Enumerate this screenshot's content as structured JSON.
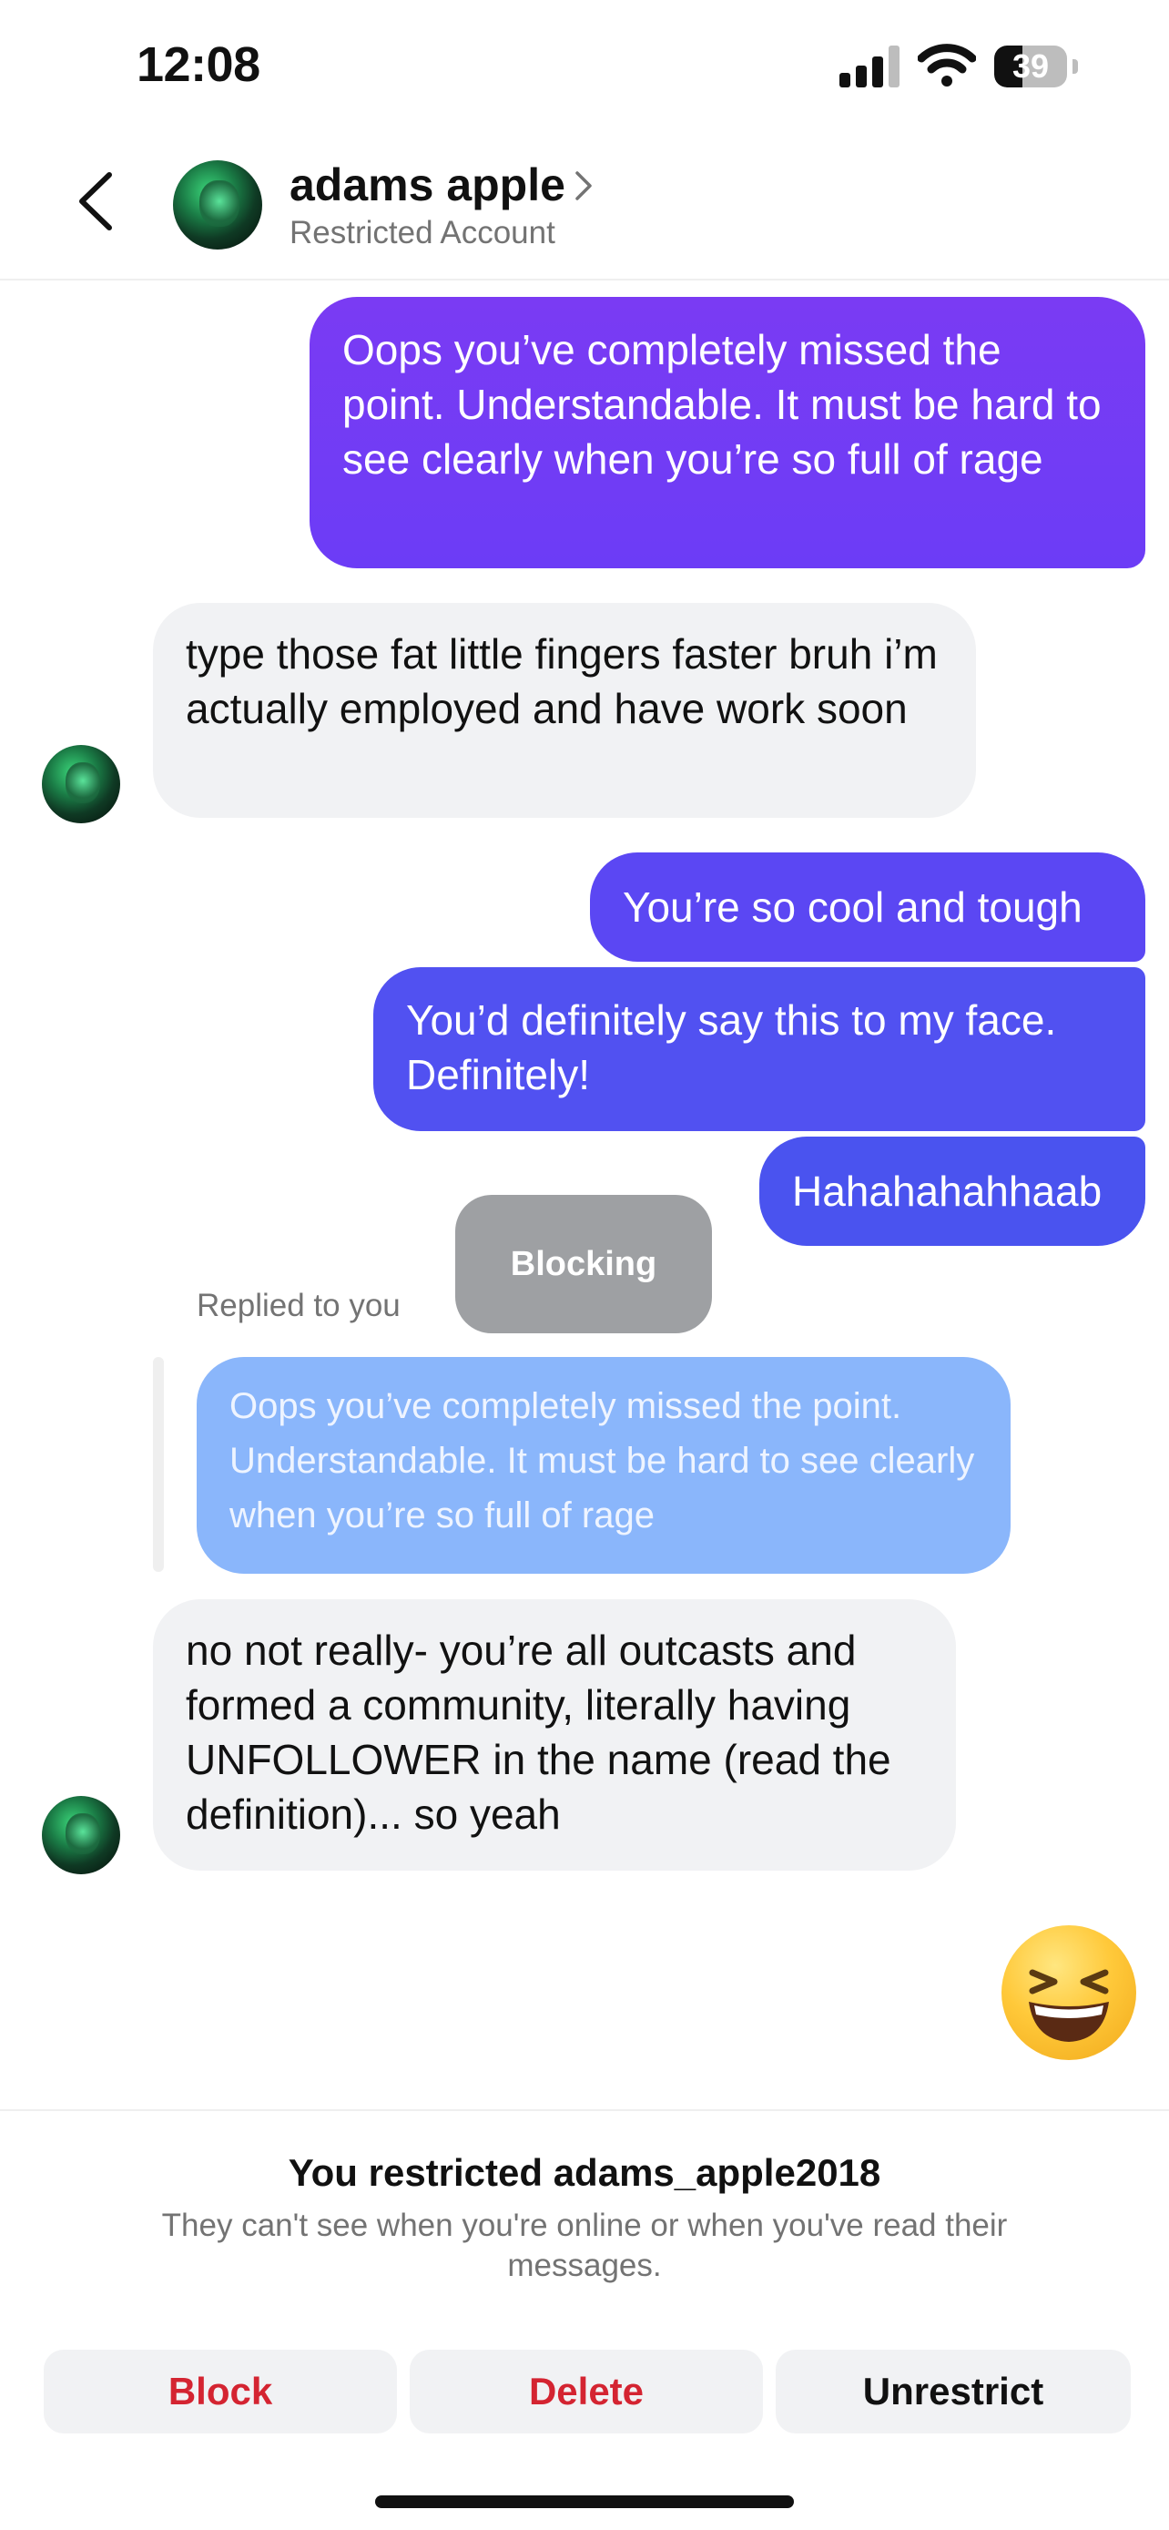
{
  "status_bar": {
    "time": "12:08",
    "battery": "39"
  },
  "header": {
    "name": "adams apple",
    "subtitle": "Restricted Account",
    "icons": {
      "back": "chevron-left-icon",
      "profile_chevron": "chevron-right-icon"
    }
  },
  "messages": [
    {
      "direction": "outgoing",
      "text": "Oops you’ve completely missed the point. Understandable. It must be hard to see clearly when you’re so full of rage"
    },
    {
      "direction": "incoming",
      "text": "type those fat little fingers faster bruh i’m actually employed and have work soon"
    },
    {
      "direction": "outgoing",
      "text": "You’re so cool and tough"
    },
    {
      "direction": "outgoing",
      "text": "You’d definitely say this to my face. Definitely!"
    },
    {
      "direction": "outgoing",
      "text": "Hahahahahhaab"
    },
    {
      "direction": "incoming",
      "text": "no not really- you’re all outcasts and formed a community, literally having UNFOLLOWER in the name (read the definition)... so yeah"
    }
  ],
  "reply": {
    "label": "Replied to you",
    "quoted_text": "Oops you’ve completely missed the point. Understandable. It must be hard to see clearly when you’re so full of rage"
  },
  "toast": {
    "text": "Blocking"
  },
  "emoji_message": {
    "icon": "grinning-squinting-face-emoji"
  },
  "restriction": {
    "title": "You restricted adams_apple2018",
    "subtitle": "They can't see when you're online or when you've read their messages."
  },
  "actions": {
    "block": "Block",
    "delete": "Delete",
    "unrestrict": "Unrestrict"
  },
  "colors": {
    "outgoing_gradient": [
      "#7a3bf3",
      "#4a53ef"
    ],
    "incoming_bg": "#f1f2f4",
    "reply_quote_bg": "#8ab6fb",
    "danger": "#d42431",
    "secondary_text": "#737373"
  }
}
